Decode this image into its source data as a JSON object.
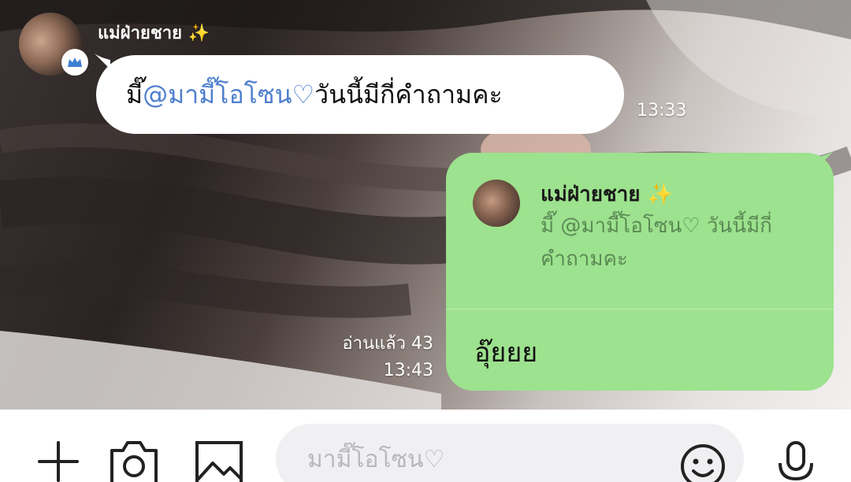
{
  "incoming_message": {
    "sender_name": "แม่ฝ่ายชาย ✨",
    "text_prefix": "มี๊ ",
    "mention": "@มามี๊โอโซน♡",
    "text_suffix": " วันนี้มีกี่คำถามคะ",
    "time": "13:33"
  },
  "outgoing_message": {
    "reply_to": {
      "sender_name": "แม่ฝ่ายชาย ✨",
      "text": "มี๊ @มามี๊โอโซน♡ วันนี้มีกี่คำถามคะ"
    },
    "text": "อุ๊ยยย",
    "read_status": "อ่านแล้ว 43",
    "time": "13:43"
  },
  "input_bar": {
    "placeholder": "มามี๊โอโซน♡",
    "value": ""
  },
  "icons": [
    "plus-icon",
    "camera-icon",
    "image-icon",
    "smile-icon",
    "mic-icon",
    "crown-icon"
  ],
  "colors": {
    "outgoing_bubble": "#9de28e",
    "mention": "#4f7fce",
    "crown_badge": "#3f7fd1"
  }
}
